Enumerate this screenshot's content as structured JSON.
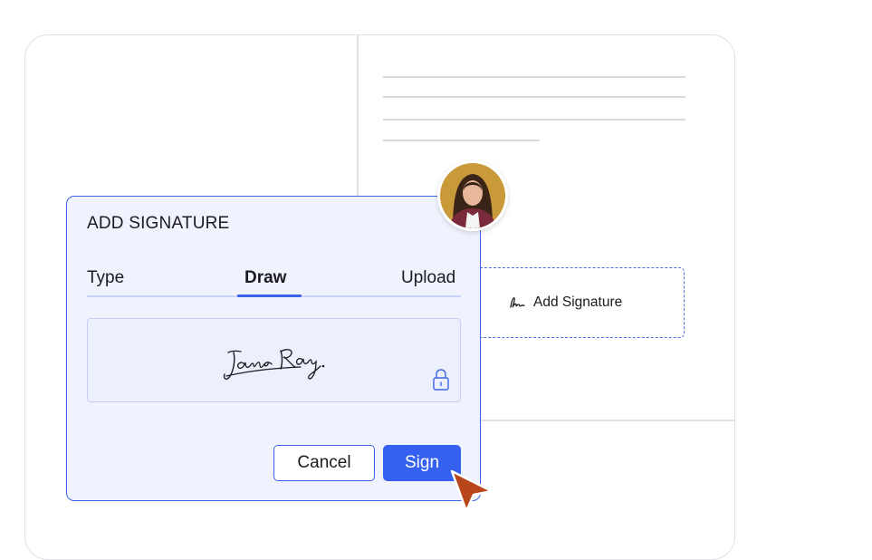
{
  "modal": {
    "title": "ADD SIGNATURE",
    "tabs": [
      {
        "label": "Type",
        "active": false
      },
      {
        "label": "Draw",
        "active": true
      },
      {
        "label": "Upload",
        "active": false
      }
    ],
    "canvas": {
      "signature_text": "Jane Ray.",
      "lock_icon": "lock-icon"
    },
    "buttons": {
      "cancel_label": "Cancel",
      "sign_label": "Sign"
    }
  },
  "document": {
    "signature_field_label": "Add Signature",
    "signature_field_icon": "signature-icon"
  },
  "colors": {
    "accent": "#3560f0",
    "modal_bg": "#f0f3fd",
    "cursor": "#b8461b"
  }
}
